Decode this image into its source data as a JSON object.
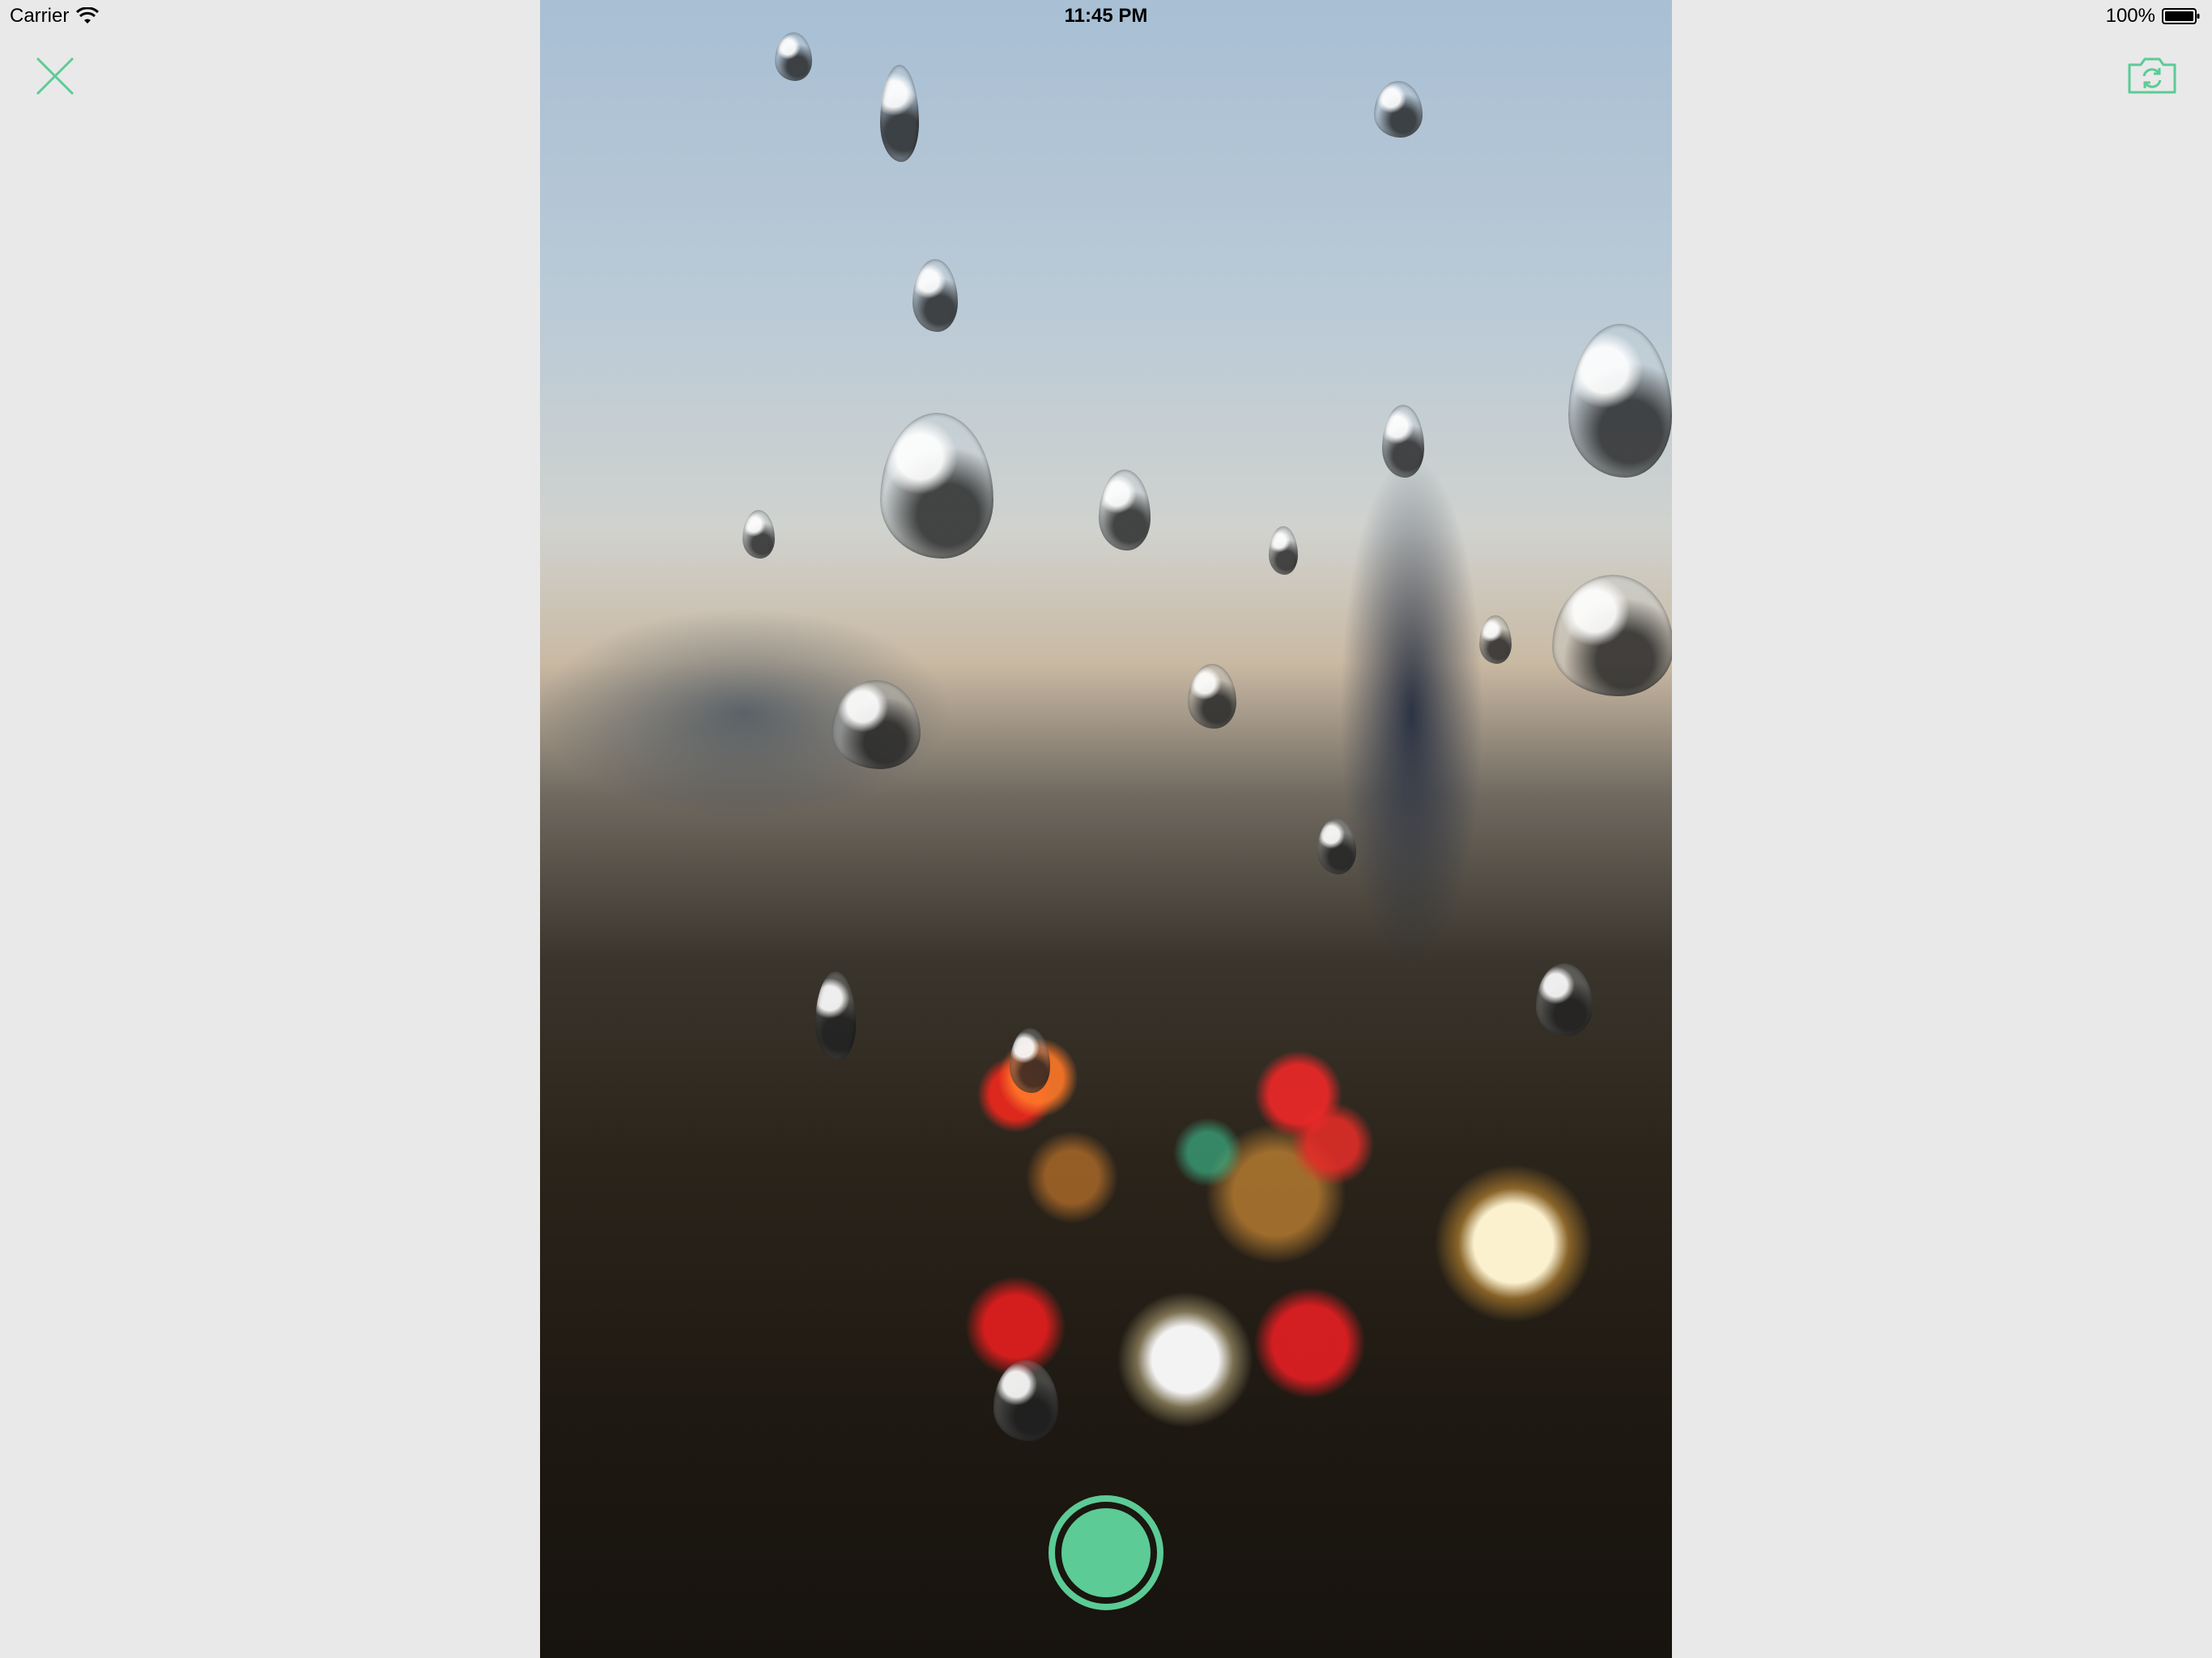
{
  "status_bar": {
    "carrier": "Carrier",
    "time": "11:45 PM",
    "battery_percent": "100%"
  },
  "toolbar": {
    "close_icon": "close-icon",
    "switch_camera_icon": "camera-switch-icon"
  },
  "camera": {
    "shutter_icon": "shutter-icon"
  },
  "colors": {
    "accent": "#5ccb96",
    "background": "#e9e9e9"
  }
}
